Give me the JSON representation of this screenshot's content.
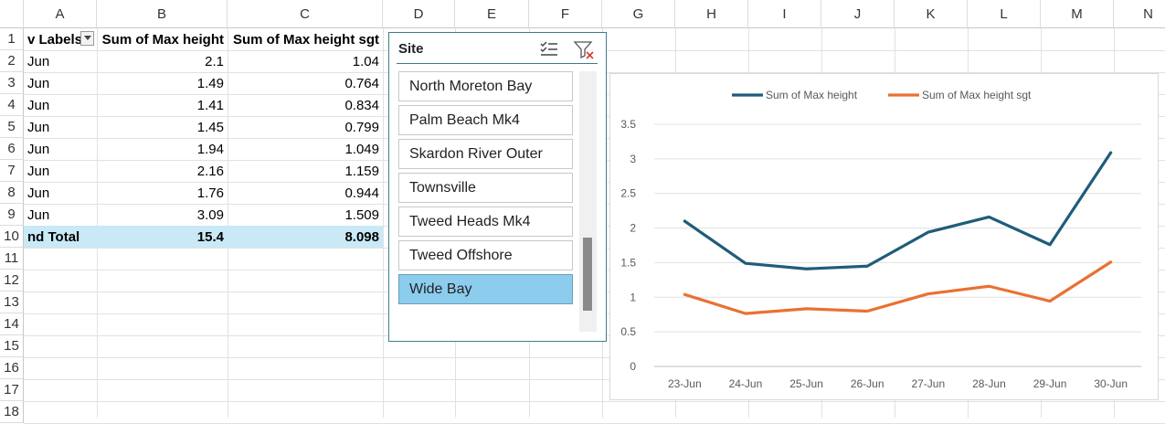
{
  "columns": [
    "A",
    "B",
    "C",
    "D",
    "E",
    "F",
    "G",
    "H",
    "I",
    "J",
    "K",
    "L",
    "M",
    "N"
  ],
  "rows": [
    "1",
    "2",
    "3",
    "4",
    "5",
    "6",
    "7",
    "8",
    "9",
    "10",
    "11",
    "12",
    "13",
    "14",
    "15",
    "16",
    "17",
    "18"
  ],
  "pivot": {
    "header": {
      "row_labels": "v Labels",
      "col_b": "Sum of Max height",
      "col_c": "Sum of Max height sgt"
    },
    "data": [
      {
        "label": "Jun",
        "b": "2.1",
        "c": "1.04"
      },
      {
        "label": "Jun",
        "b": "1.49",
        "c": "0.764"
      },
      {
        "label": "Jun",
        "b": "1.41",
        "c": "0.834"
      },
      {
        "label": "Jun",
        "b": "1.45",
        "c": "0.799"
      },
      {
        "label": "Jun",
        "b": "1.94",
        "c": "1.049"
      },
      {
        "label": "Jun",
        "b": "2.16",
        "c": "1.159"
      },
      {
        "label": "Jun",
        "b": "1.76",
        "c": "0.944"
      },
      {
        "label": "Jun",
        "b": "3.09",
        "c": "1.509"
      }
    ],
    "total": {
      "label": "nd Total",
      "b": "15.4",
      "c": "8.098"
    }
  },
  "slicer": {
    "title": "Site",
    "items": [
      {
        "label": "North Moreton Bay",
        "selected": false
      },
      {
        "label": "Palm Beach Mk4",
        "selected": false
      },
      {
        "label": "Skardon River Outer",
        "selected": false
      },
      {
        "label": "Townsville",
        "selected": false
      },
      {
        "label": "Tweed Heads Mk4",
        "selected": false
      },
      {
        "label": "Tweed Offshore",
        "selected": false
      },
      {
        "label": "Wide Bay",
        "selected": true
      }
    ],
    "icons": [
      "multi-select-icon",
      "clear-filter-icon"
    ]
  },
  "colors": {
    "series1": "#1f5c7a",
    "series2": "#e97132",
    "selected": "#8ccdee",
    "total_fill": "#c9e9f7"
  },
  "chart_data": {
    "type": "line",
    "title": "",
    "categories": [
      "23-Jun",
      "24-Jun",
      "25-Jun",
      "26-Jun",
      "27-Jun",
      "28-Jun",
      "29-Jun",
      "30-Jun"
    ],
    "series": [
      {
        "name": "Sum of Max height",
        "values": [
          2.1,
          1.49,
          1.41,
          1.45,
          1.94,
          2.16,
          1.76,
          3.09
        ]
      },
      {
        "name": "Sum of Max height sgt",
        "values": [
          1.04,
          0.764,
          0.834,
          0.799,
          1.049,
          1.159,
          0.944,
          1.509
        ]
      }
    ],
    "yticks": [
      "0",
      "0.5",
      "1",
      "1.5",
      "2",
      "2.5",
      "3",
      "3.5"
    ],
    "ylim": [
      0,
      3.5
    ],
    "grid": true,
    "legend": "top"
  }
}
